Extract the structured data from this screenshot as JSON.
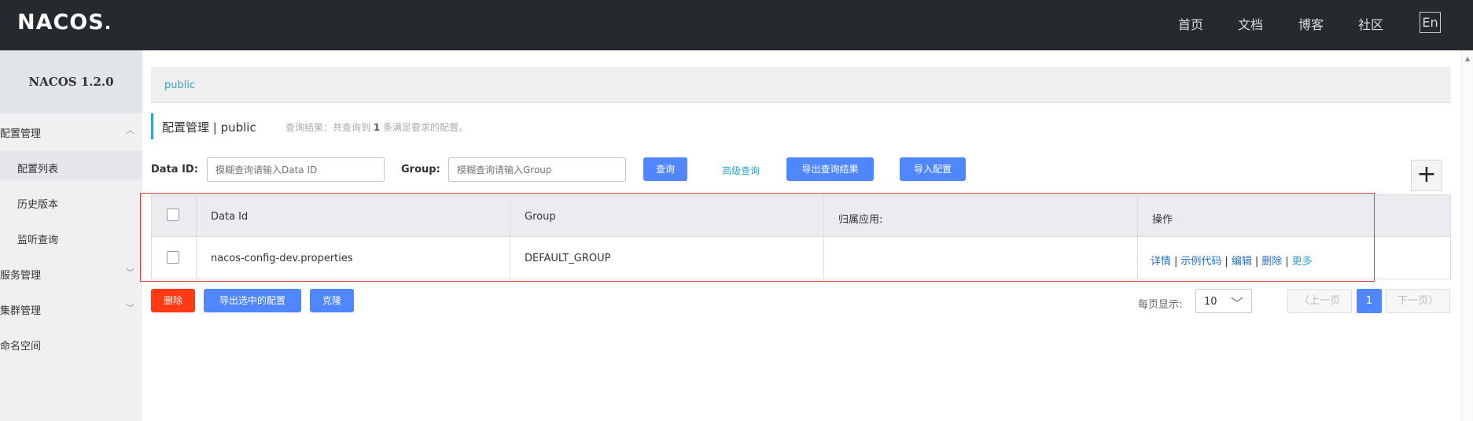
{
  "header": {
    "logo_text": "NACOS",
    "nav": [
      "首页",
      "文档",
      "博客",
      "社区"
    ],
    "lang_label": "En"
  },
  "sidebar": {
    "title": "NACOS 1.2.0",
    "menus": [
      {
        "label": "配置管理",
        "expanded": true
      },
      {
        "label": "配置列表"
      },
      {
        "label": "历史版本"
      },
      {
        "label": "监听查询"
      },
      {
        "label": "服务管理",
        "expanded": false
      },
      {
        "label": "集群管理",
        "expanded": false
      },
      {
        "label": "命名空间"
      }
    ]
  },
  "breadcrumb": "public",
  "page": {
    "title": "配置管理 | public",
    "result_prefix": "查询结果：共查询到",
    "result_count": "1",
    "result_suffix": "条满足要求的配置。"
  },
  "filters": {
    "dataid_label": "Data ID:",
    "dataid_placeholder": "模糊查询请输入Data ID",
    "group_label": "Group:",
    "group_placeholder": "模糊查询请输入Group",
    "query_btn": "查询",
    "advanced_link": "高级查询",
    "export_results_btn": "导出查询结果",
    "import_btn": "导入配置",
    "add_btn": "+"
  },
  "table": {
    "columns": [
      "Data Id",
      "Group",
      "归属应用:",
      "操作"
    ],
    "rows": [
      {
        "data_id": "nacos-config-dev.properties",
        "group": "DEFAULT_GROUP",
        "app": ""
      }
    ],
    "actions": [
      "详情",
      "示例代码",
      "编辑",
      "删除",
      "更多"
    ]
  },
  "bulk": {
    "delete_btn": "删除",
    "export_selected_btn": "导出选中的配置",
    "clone_btn": "克隆"
  },
  "pagination": {
    "page_size_label": "每页显示:",
    "page_size": "10",
    "prev": "上一页",
    "current": "1",
    "next": "下一页"
  },
  "colors": {
    "topbar": "#252a2f",
    "accent": "#2ca6c9",
    "primary": "#5087ff",
    "danger": "#ff3a15",
    "highlight_border": "#e23b3b"
  }
}
